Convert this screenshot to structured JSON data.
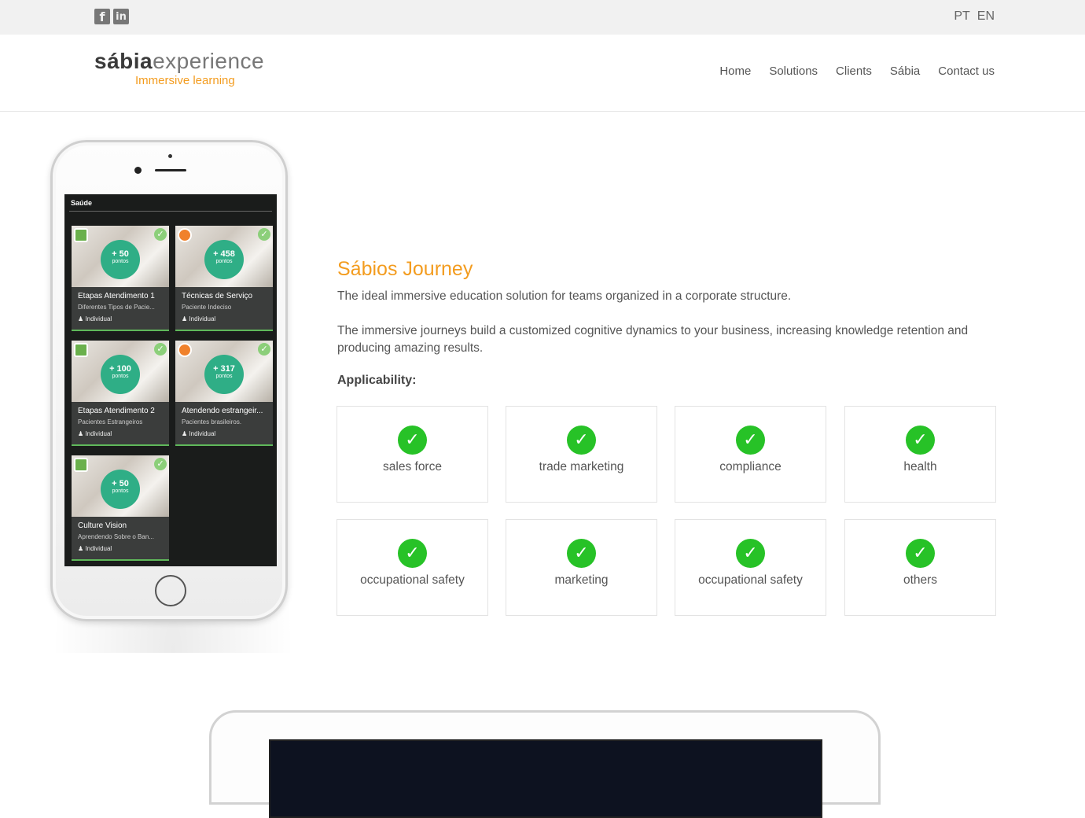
{
  "topbar": {
    "social": [
      {
        "name": "facebook-icon",
        "glyph": "f"
      },
      {
        "name": "linkedin-icon",
        "glyph": "in"
      }
    ],
    "languages": [
      "PT",
      "EN"
    ]
  },
  "header": {
    "logo": {
      "word1": "sábia",
      "word2": "experience",
      "tagline": "Immersive learning"
    },
    "nav": [
      "Home",
      "Solutions",
      "Clients",
      "Sábia",
      "Contact us"
    ]
  },
  "phone": {
    "screen_title": "Saúde",
    "cards": [
      {
        "points": "+ 50",
        "points_label": "pontos",
        "title": "Etapas Atendimento 1",
        "subtitle": "Diferentes Tipos de Pacie...",
        "type": "Individual",
        "icon": "green"
      },
      {
        "points": "+ 458",
        "points_label": "pontos",
        "title": "Técnicas de Serviço",
        "subtitle": "Paciente Indeciso",
        "type": "Individual",
        "icon": "orange"
      },
      {
        "points": "+ 100",
        "points_label": "pontos",
        "title": "Etapas Atendimento 2",
        "subtitle": "Pacientes Estrangeiros",
        "type": "Individual",
        "icon": "green"
      },
      {
        "points": "+ 317",
        "points_label": "pontos",
        "title": "Atendendo estrangeir...",
        "subtitle": "Pacientes brasileiros.",
        "type": "Individual",
        "icon": "orange"
      },
      {
        "points": "+ 50",
        "points_label": "pontos",
        "title": "Culture Vision",
        "subtitle": "Aprendendo Sobre o Ban...",
        "type": "Individual",
        "icon": "green"
      }
    ]
  },
  "content": {
    "title": "Sábios Journey",
    "intro": "The ideal immersive education solution for teams organized in a corporate structure.",
    "description": "The immersive journeys build a customized cognitive dynamics to your business, increasing knowledge retention and producing amazing results.",
    "applicability_label": "Applicability:",
    "applicability": [
      "sales force",
      "trade marketing",
      "compliance",
      "health",
      "occupational safety",
      "marketing",
      "occupational safety",
      "others"
    ]
  },
  "colors": {
    "accent": "#f39c1f",
    "check": "#27c227",
    "points_badge": "#2fae86"
  }
}
